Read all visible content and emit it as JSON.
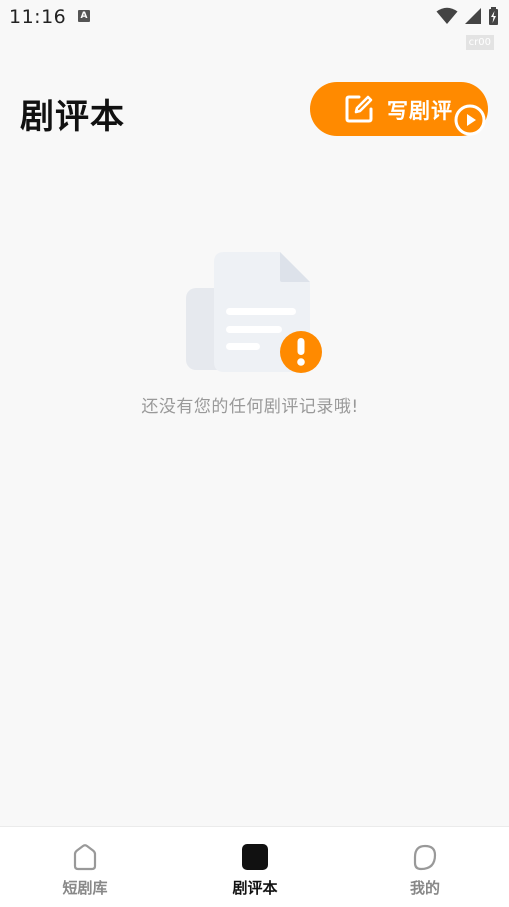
{
  "status_bar": {
    "time": "11:16",
    "notification_glyph": "A",
    "badge": "cr00"
  },
  "header": {
    "title": "剧评本",
    "write_button_label": "写剧评"
  },
  "empty_state": {
    "message": "还没有您的任何剧评记录哦!"
  },
  "bottom_nav": {
    "items": [
      {
        "label": "短剧库",
        "icon": "home-icon",
        "active": false
      },
      {
        "label": "剧评本",
        "icon": "review-book-icon",
        "active": true
      },
      {
        "label": "我的",
        "icon": "profile-icon",
        "active": false
      }
    ]
  },
  "colors": {
    "accent": "#ff8a00",
    "background": "#f8f8f8",
    "active_text": "#111111",
    "inactive_text": "#888888"
  }
}
